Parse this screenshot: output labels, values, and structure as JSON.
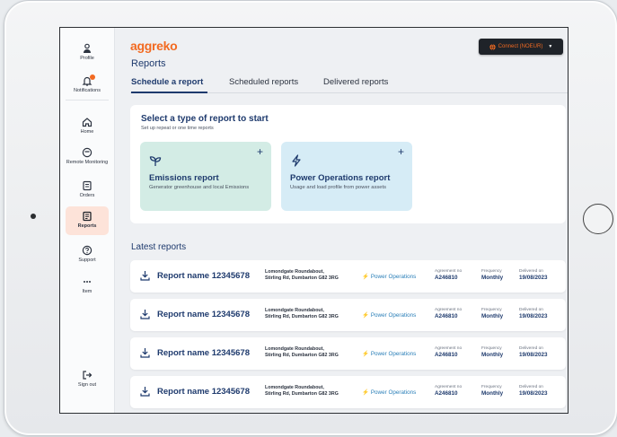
{
  "sidebar": {
    "items": [
      {
        "label": "Profile",
        "icon": "person-icon"
      },
      {
        "label": "Notifications",
        "icon": "bell-icon"
      },
      {
        "label": "Home",
        "icon": "home-icon"
      },
      {
        "label": "Remote Monitoring",
        "icon": "gauge-icon"
      },
      {
        "label": "Orders",
        "icon": "orders-icon"
      },
      {
        "label": "Reports",
        "icon": "reports-icon"
      },
      {
        "label": "Support",
        "icon": "help-icon"
      },
      {
        "label": "Item",
        "icon": "more-icon"
      },
      {
        "label": "Sign out",
        "icon": "sign-out-icon"
      }
    ]
  },
  "header": {
    "logo": "aggreko",
    "title": "Reports",
    "connect_label": "Connect (NOEUR)"
  },
  "tabs": [
    {
      "label": "Schedule a report",
      "active": true
    },
    {
      "label": "Scheduled reports",
      "active": false
    },
    {
      "label": "Delivered reports",
      "active": false
    }
  ],
  "select": {
    "title": "Select a type of report to start",
    "subtitle": "Set up repeat or one time reports",
    "types": [
      {
        "name": "Emissions report",
        "description": "Generator greenhouse and local Emissions",
        "plus": "+",
        "color": "#d3ece5"
      },
      {
        "name": "Power Operations report",
        "description": "Usage and load profile from power assets",
        "plus": "+",
        "color": "#d6ecf6"
      }
    ]
  },
  "latest": {
    "title": "Latest reports",
    "labels": {
      "agreement": "Agreement no",
      "frequency": "Frequency",
      "delivered": "Delivered on"
    },
    "rows": [
      {
        "name": "Report name 12345678",
        "address_line1": "Lomondgate Roundabout,",
        "address_line2": "Stirling Rd, Dumbarton G82 3RG",
        "type": "Power Operations",
        "agreement": "A246810",
        "frequency": "Monthly",
        "delivered": "19/08/2023"
      },
      {
        "name": "Report name 12345678",
        "address_line1": "Lomondgate Roundabout,",
        "address_line2": "Stirling Rd, Dumbarton G82 3RG",
        "type": "Power Operations",
        "agreement": "A246810",
        "frequency": "Monthly",
        "delivered": "19/08/2023"
      },
      {
        "name": "Report name 12345678",
        "address_line1": "Lomondgate Roundabout,",
        "address_line2": "Stirling Rd, Dumbarton G82 3RG",
        "type": "Power Operations",
        "agreement": "A246810",
        "frequency": "Monthly",
        "delivered": "19/08/2023"
      },
      {
        "name": "Report name 12345678",
        "address_line1": "Lomondgate Roundabout,",
        "address_line2": "Stirling Rd, Dumbarton G82 3RG",
        "type": "Power Operations",
        "agreement": "A246810",
        "frequency": "Monthly",
        "delivered": "19/08/2023"
      }
    ]
  },
  "colors": {
    "brand": "#f26a21",
    "navy": "#1e3a6d",
    "active_nav": "#fde3d9"
  }
}
